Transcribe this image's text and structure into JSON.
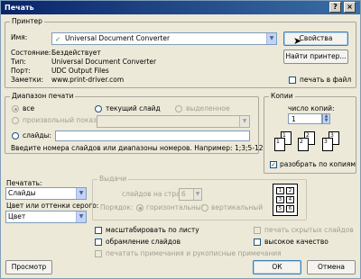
{
  "window": {
    "title": "Печать",
    "help": "?",
    "close": "×"
  },
  "printer": {
    "group": "Принтер",
    "name_label": "Имя:",
    "name_value": "Universal Document Converter",
    "props": "Свойства",
    "find": "Найти принтер...",
    "state_label": "Состояние:",
    "state_value": "Бездействует",
    "type_label": "Тип:",
    "type_value": "Universal Document Converter",
    "port_label": "Порт:",
    "port_value": "UDC Output Files",
    "notes_label": "Заметки:",
    "notes_value": "www.print-driver.com",
    "to_file": "печать в файл"
  },
  "range": {
    "group": "Диапазон печати",
    "all": "все",
    "current": "текущий слайд",
    "selection": "выделенное",
    "custom": "произвольный показ:",
    "slides": "слайды:",
    "hint": "Введите номера слайдов или диапазоны номеров. Например: 1;3;5-12"
  },
  "copies": {
    "group": "Копии",
    "count_label": "число копий:",
    "count_value": "1",
    "collate": "разобрать по копиям"
  },
  "print_what": {
    "label": "Печатать:",
    "value": "Слайды"
  },
  "color": {
    "label": "Цвет или оттенки серого:",
    "value": "Цвет"
  },
  "handouts": {
    "group": "Выдачи",
    "per_page_label": "слайдов на странице:",
    "per_page_value": "6",
    "order_label": "Порядок:",
    "horizontal": "горизонтальный",
    "vertical": "вертикальный",
    "thumbs": [
      "1",
      "2",
      "3",
      "4",
      "5",
      "6"
    ]
  },
  "options": {
    "scale": "масштабировать по листу",
    "frame": "обрамление слайдов",
    "notes": "печатать примечания и рукописные примечания",
    "hidden": "печать скрытых слайдов",
    "quality": "высокое качество"
  },
  "footer": {
    "preview": "Просмотр",
    "ok": "ОК",
    "cancel": "Отмена"
  },
  "copy_pages": [
    "1",
    "1",
    "2",
    "2",
    "3",
    "3"
  ]
}
